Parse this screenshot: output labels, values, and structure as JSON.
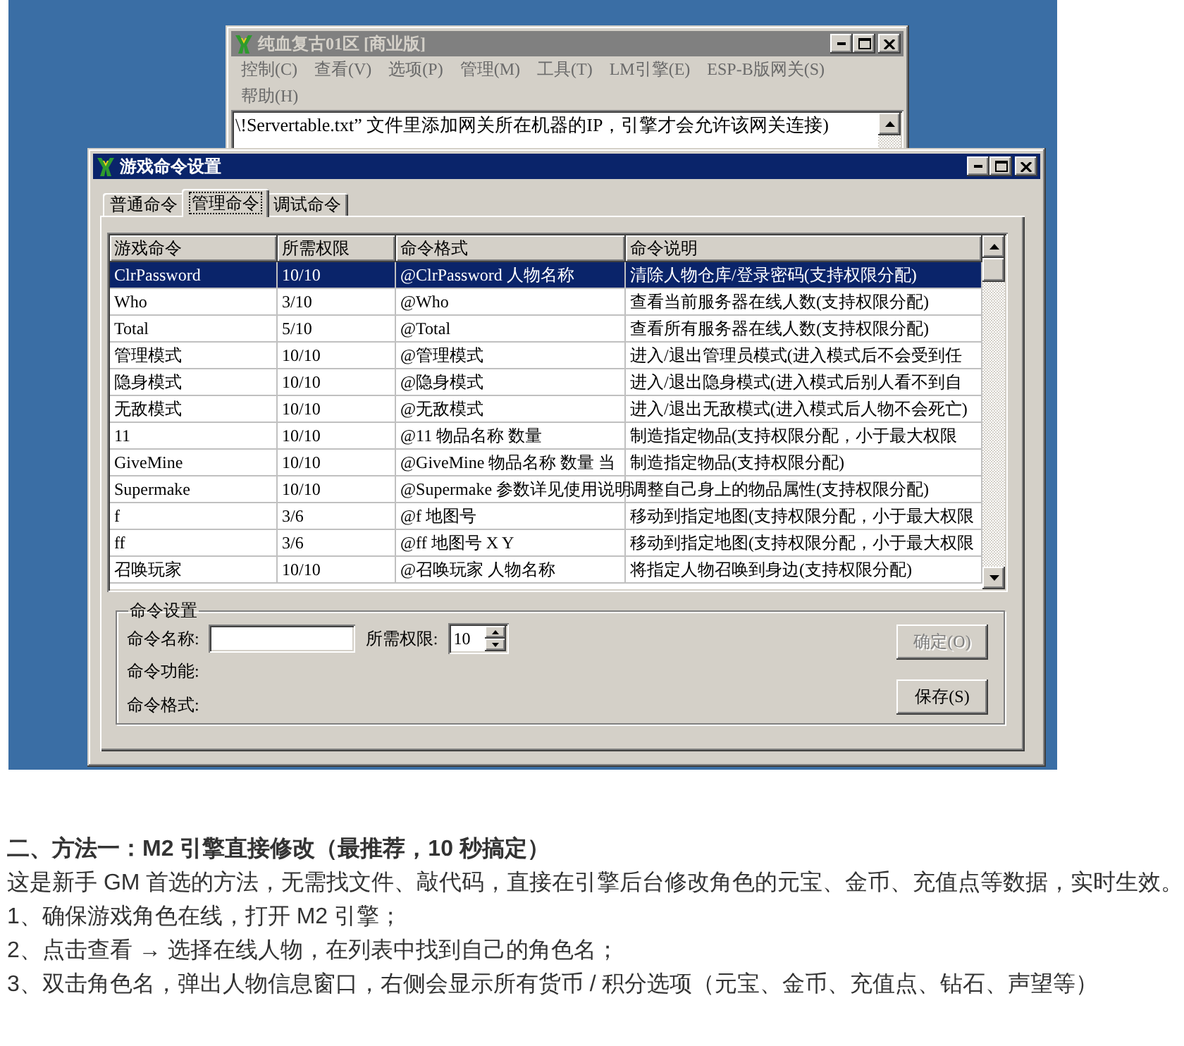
{
  "background_window": {
    "title": "纯血复古01区 [商业版]",
    "active": false,
    "menu_rows": [
      [
        "控制(C)",
        "查看(V)",
        "选项(P)",
        "管理(M)",
        "工具(T)",
        "LM引擎(E)",
        "ESP-B版网关(S)"
      ],
      [
        "帮助(H)"
      ]
    ],
    "log_lines": [
      "\\!Servertable.txt” 文件里添加网关所在机器的IP，引擎才会允许该网关连接)"
    ]
  },
  "dialog": {
    "title": "游戏命令设置",
    "active": true,
    "tabs": [
      {
        "label": "普通命令",
        "selected": false
      },
      {
        "label": "管理命令",
        "selected": true
      },
      {
        "label": "调试命令",
        "selected": false
      }
    ],
    "table": {
      "columns": [
        "游戏命令",
        "所需权限",
        "命令格式",
        "命令说明"
      ],
      "rows": [
        {
          "cells": [
            "ClrPassword",
            "10/10",
            "@ClrPassword 人物名称",
            "清除人物仓库/登录密码(支持权限分配)"
          ],
          "selected": true
        },
        {
          "cells": [
            "Who",
            "3/10",
            "@Who",
            "查看当前服务器在线人数(支持权限分配)"
          ],
          "selected": false
        },
        {
          "cells": [
            "Total",
            "5/10",
            "@Total",
            "查看所有服务器在线人数(支持权限分配)"
          ],
          "selected": false
        },
        {
          "cells": [
            "管理模式",
            "10/10",
            "@管理模式",
            "进入/退出管理员模式(进入模式后不会受到任"
          ],
          "selected": false
        },
        {
          "cells": [
            "隐身模式",
            "10/10",
            "@隐身模式",
            "进入/退出隐身模式(进入模式后别人看不到自"
          ],
          "selected": false
        },
        {
          "cells": [
            "无敌模式",
            "10/10",
            "@无敌模式",
            "进入/退出无敌模式(进入模式后人物不会死亡)"
          ],
          "selected": false
        },
        {
          "cells": [
            "11",
            "10/10",
            "@11 物品名称 数量",
            "制造指定物品(支持权限分配，小于最大权限"
          ],
          "selected": false
        },
        {
          "cells": [
            "GiveMine",
            "10/10",
            "@GiveMine 物品名称 数量 当",
            "制造指定物品(支持权限分配)"
          ],
          "selected": false
        },
        {
          "cells": [
            "Supermake",
            "10/10",
            "@Supermake 参数详见使用说明",
            "调整自己身上的物品属性(支持权限分配)"
          ],
          "selected": false
        },
        {
          "cells": [
            "f",
            "3/6",
            "@f 地图号",
            "移动到指定地图(支持权限分配，小于最大权限"
          ],
          "selected": false
        },
        {
          "cells": [
            "ff",
            "3/6",
            "@ff 地图号 X Y",
            "移动到指定地图(支持权限分配，小于最大权限"
          ],
          "selected": false
        },
        {
          "cells": [
            "召唤玩家",
            "10/10",
            "@召唤玩家 人物名称",
            "将指定人物召唤到身边(支持权限分配)"
          ],
          "selected": false
        }
      ]
    },
    "command_settings": {
      "legend": "命令设置",
      "name_label": "命令名称:",
      "permission_label": "所需权限:",
      "permission_value": "10",
      "function_label": "命令功能:",
      "format_label": "命令格式:",
      "buttons": [
        {
          "label": "确定(O)",
          "disabled": true
        },
        {
          "label": "保存(S)",
          "disabled": false
        }
      ]
    }
  },
  "article": {
    "heading": "二、方法一：M2 引擎直接修改（最推荐，10 秒搞定）",
    "paragraphs": [
      "这是新手 GM 首选的方法，无需找文件、敲代码，直接在引擎后台修改角色的元宝、金币、充值点等数据，实时生效。",
      "1、确保游戏角色在线，打开 M2 引擎；",
      "2、点击查看 → 选择在线人物，在列表中找到自己的角色名；",
      "3、双击角色名，弹出人物信息窗口，右侧会显示所有货币 / 积分选项（元宝、金币、充值点、钻石、声望等）"
    ]
  }
}
